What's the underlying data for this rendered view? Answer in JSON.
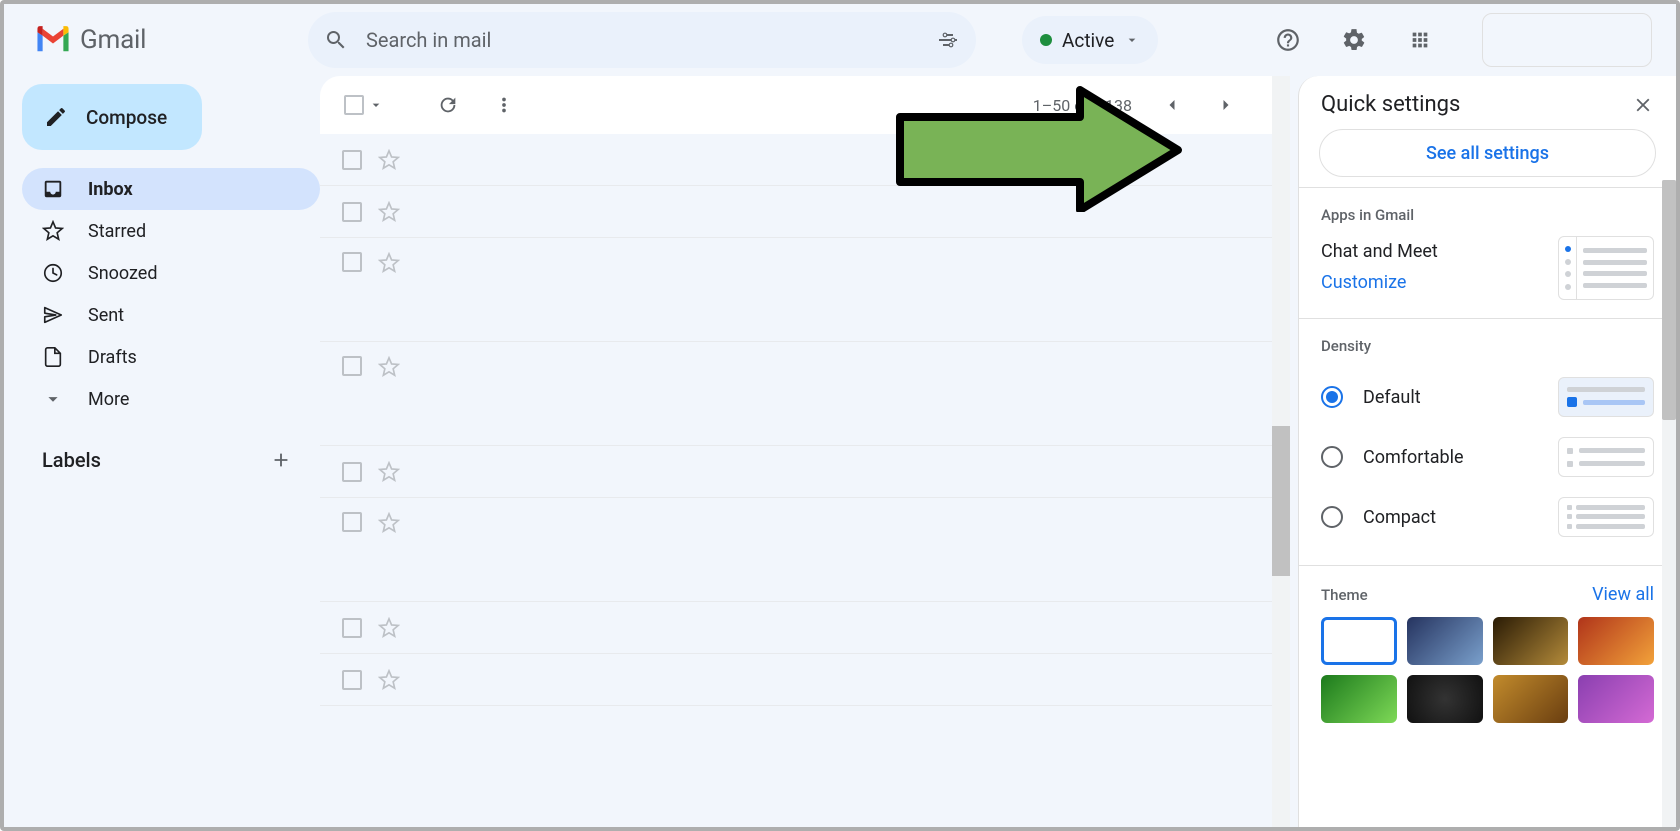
{
  "brand": {
    "name": "Gmail"
  },
  "search": {
    "placeholder": "Search in mail"
  },
  "status": {
    "label": "Active"
  },
  "compose": {
    "label": "Compose"
  },
  "sidebar": {
    "items": [
      {
        "label": "Inbox"
      },
      {
        "label": "Starred"
      },
      {
        "label": "Snoozed"
      },
      {
        "label": "Sent"
      },
      {
        "label": "Drafts"
      },
      {
        "label": "More"
      }
    ],
    "labels_header": "Labels"
  },
  "toolbar": {
    "pager_text": "1–50 of 2,138"
  },
  "quick_settings": {
    "title": "Quick settings",
    "see_all": "See all settings",
    "apps_header": "Apps in Gmail",
    "apps_title": "Chat and Meet",
    "apps_link": "Customize",
    "density_header": "Density",
    "density": [
      {
        "label": "Default",
        "selected": true
      },
      {
        "label": "Comfortable",
        "selected": false
      },
      {
        "label": "Compact",
        "selected": false
      }
    ],
    "theme_header": "Theme",
    "view_all": "View all"
  }
}
